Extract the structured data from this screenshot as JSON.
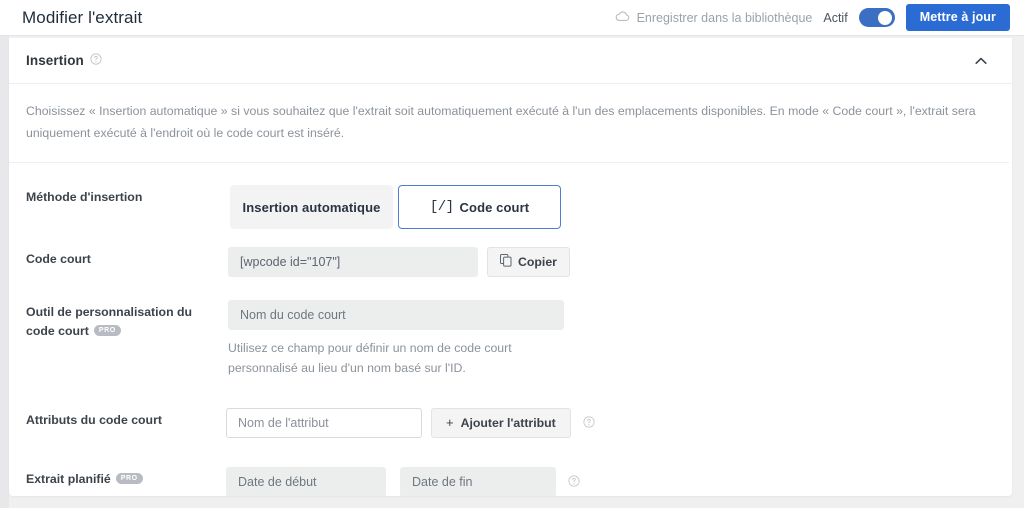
{
  "header": {
    "title": "Modifier l'extrait",
    "library_save_label": "Enregistrer dans la bibliothèque",
    "cloud_icon": "cloud-icon",
    "active_label": "Actif",
    "toggle_state": "on",
    "update_button": "Mettre à jour",
    "accent_color": "#2b6cd4",
    "toggle_color": "#3a6fc4"
  },
  "panel": {
    "title": "Insertion",
    "help_icon": "help-circle-icon",
    "collapse_icon": "chevron-up-icon",
    "description": "Choisissez « Insertion automatique » si vous souhaitez que l'extrait soit automatiquement exécuté à l'un des emplacements disponibles. En mode « Code court », l'extrait sera uniquement exécuté à l'endroit où le code court est inséré."
  },
  "fields": {
    "method": {
      "label": "Méthode d'insertion",
      "options": [
        {
          "label": "Insertion automatique",
          "selected": false
        },
        {
          "label": "Code court",
          "selected": true,
          "glyph": "[/]"
        }
      ]
    },
    "shortcode": {
      "label": "Code court",
      "value": "[wpcode id=\"107\"]",
      "copy_label": "Copier",
      "copy_icon": "copy-icon"
    },
    "custom_shortcode": {
      "label": "Outil de personnalisation du code court",
      "pro_badge": "PRO",
      "placeholder": "Nom du code court",
      "hint": "Utilisez ce champ pour définir un nom de code court personnalisé au lieu d'un nom basé sur l'ID."
    },
    "attributes": {
      "label": "Attributs du code court",
      "placeholder": "Nom de l'attribut",
      "add_label": "Ajouter l'attribut",
      "add_glyph": "+",
      "help_icon": "help-circle-icon"
    },
    "scheduled": {
      "label": "Extrait planifié",
      "pro_badge": "PRO",
      "start_placeholder": "Date de début",
      "end_placeholder": "Date de fin",
      "help_icon": "help-circle-icon"
    }
  }
}
